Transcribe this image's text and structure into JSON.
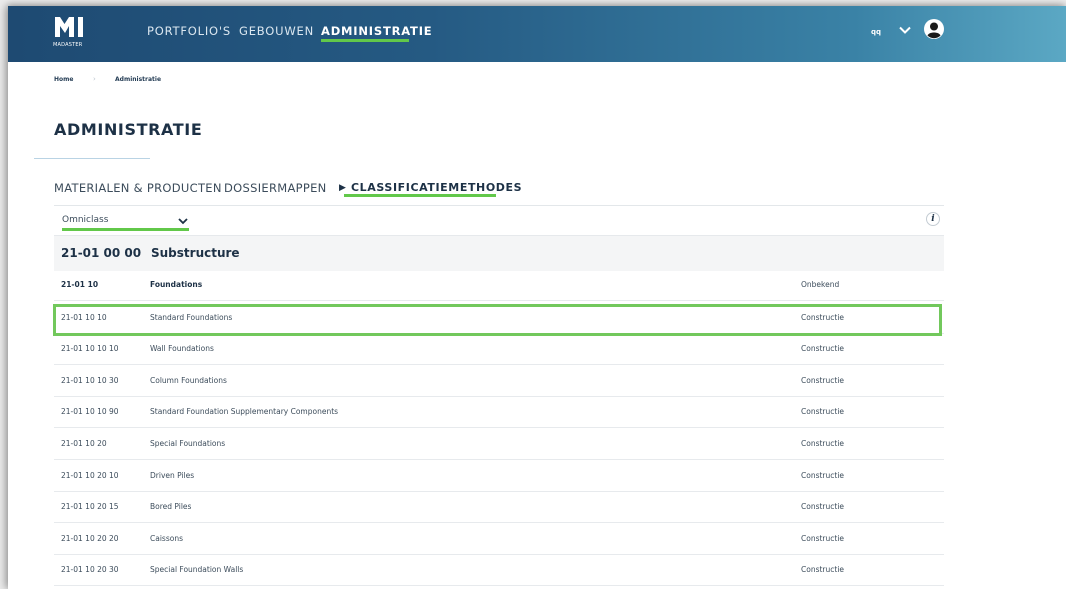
{
  "header": {
    "logo_text": "MADASTER",
    "nav": [
      {
        "label": "PORTFOLIO'S"
      },
      {
        "label": "GEBOUWEN"
      },
      {
        "label": "ADMINISTRATIE"
      }
    ],
    "active_nav": "ADMINISTRATIE",
    "user_initials": "qq"
  },
  "breadcrumb": [
    "Home",
    "Administratie"
  ],
  "page_title": "ADMINISTRATIE",
  "tabs": [
    {
      "label": "MATERIALEN & PRODUCTEN"
    },
    {
      "label": "DOSSIERMAPPEN"
    },
    {
      "label": "CLASSIFICATIEMETHODES"
    }
  ],
  "active_tab": "CLASSIFICATIEMETHODES",
  "classification_select": {
    "value": "Omniclass"
  },
  "info_label": "i",
  "group": {
    "code": "21-01 00 00",
    "name": "Substructure"
  },
  "rows": [
    {
      "code": "21-01 10",
      "name": "Foundations",
      "type": "Onbekend"
    },
    {
      "code": "21-01 10 10",
      "name": "Standard Foundations",
      "type": "Constructie"
    },
    {
      "code": "21-01 10 10 10",
      "name": "Wall Foundations",
      "type": "Constructie"
    },
    {
      "code": "21-01 10 10 30",
      "name": "Column Foundations",
      "type": "Constructie"
    },
    {
      "code": "21-01 10 10 90",
      "name": "Standard Foundation Supplementary Components",
      "type": "Constructie"
    },
    {
      "code": "21-01 10 20",
      "name": "Special Foundations",
      "type": "Constructie"
    },
    {
      "code": "21-01 10 20 10",
      "name": "Driven Piles",
      "type": "Constructie"
    },
    {
      "code": "21-01 10 20 15",
      "name": "Bored Piles",
      "type": "Constructie"
    },
    {
      "code": "21-01 10 20 20",
      "name": "Caissons",
      "type": "Constructie"
    },
    {
      "code": "21-01 10 20 30",
      "name": "Special Foundation Walls",
      "type": "Constructie"
    }
  ],
  "colors": {
    "accent": "#62c84a",
    "nav_bg": "#255a83",
    "text_dark": "#1d3146"
  }
}
